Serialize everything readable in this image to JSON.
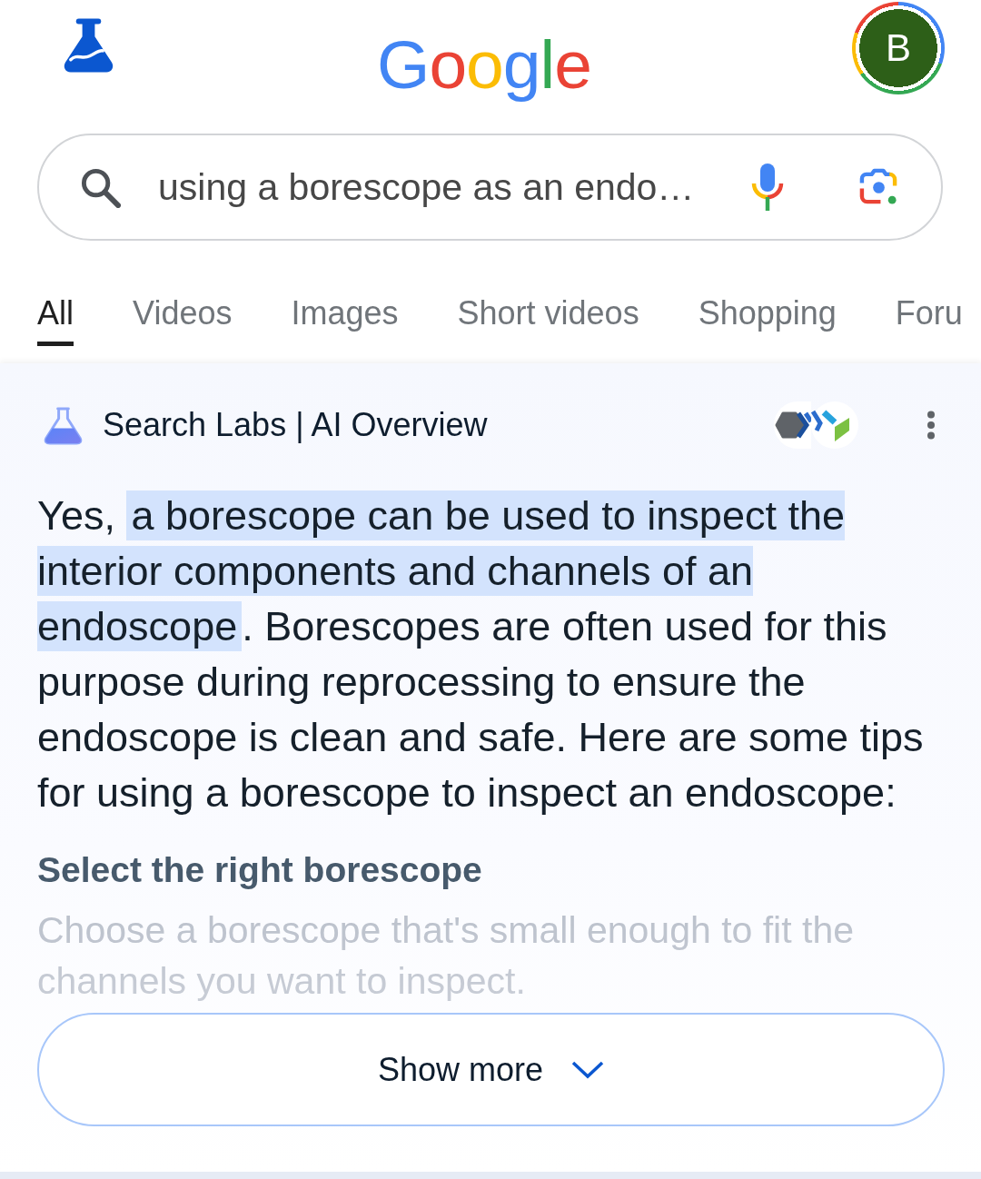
{
  "header": {
    "logo": "Google",
    "avatar_letter": "B"
  },
  "search": {
    "value": "using a borescope as an endo…"
  },
  "tabs": [
    {
      "label": "All",
      "selected": true
    },
    {
      "label": "Videos",
      "selected": false
    },
    {
      "label": "Images",
      "selected": false
    },
    {
      "label": "Short videos",
      "selected": false
    },
    {
      "label": "Shopping",
      "selected": false
    },
    {
      "label": "Foru",
      "selected": false
    }
  ],
  "ai_overview": {
    "title": "Search Labs | AI Overview",
    "summary": [
      {
        "text": "Yes, ",
        "highlighted": false
      },
      {
        "text": "a borescope can be used to inspect the interior components and channels of an endoscope",
        "highlighted": true
      },
      {
        "text": ". Borescopes are often used for this purpose during reprocessing to ensure the endoscope is clean and safe. Here are some tips for using a borescope to inspect an endoscope:",
        "highlighted": false
      }
    ],
    "sections": [
      {
        "heading": "Select the right borescope",
        "text": "Choose a borescope that's small enough to fit the channels you want to inspect."
      }
    ],
    "expanded": false,
    "show_more_label": "Show more"
  }
}
